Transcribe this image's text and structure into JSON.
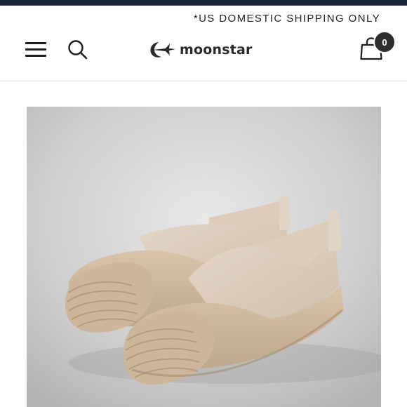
{
  "banner": {
    "shipping_notice": "*US DOMESTIC SHIPPING ONLY"
  },
  "header": {
    "logo_text": "moonstar",
    "cart_count": "0"
  },
  "icons": {
    "menu": "hamburger-menu-icon",
    "search": "search-icon",
    "cart": "shopping-bag-icon",
    "logo": "moonstar-star-logo-icon"
  },
  "colors": {
    "top_strip": "#18243a",
    "badge": "#2e2e2e",
    "shoe": "#d9c8b3",
    "background_photo": "#c6c6c6"
  }
}
